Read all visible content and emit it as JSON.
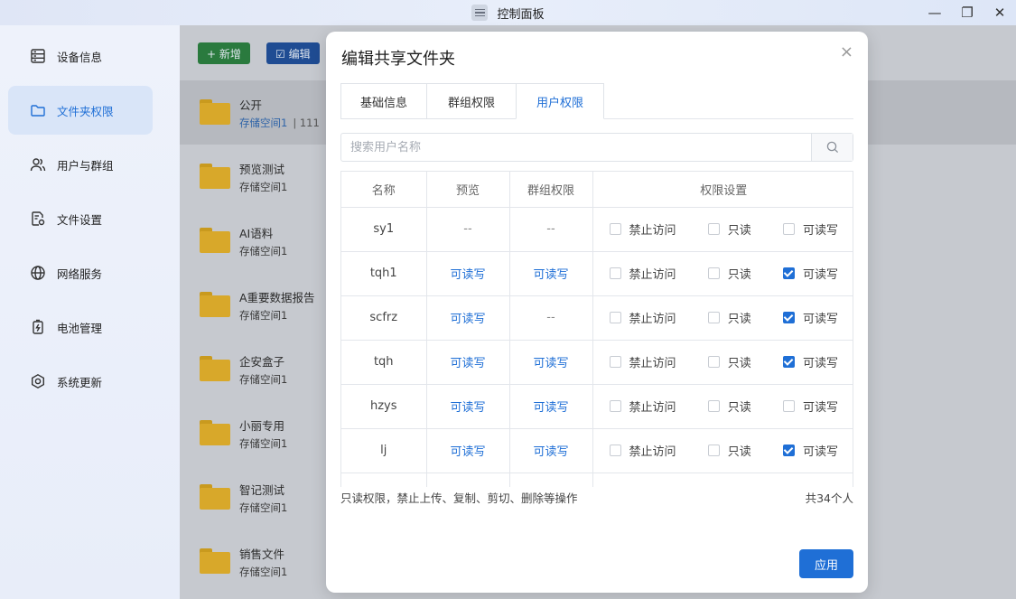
{
  "window": {
    "title": "控制面板",
    "controls": [
      "—",
      "❐",
      "✕"
    ]
  },
  "sidebar": {
    "items": [
      {
        "label": "设备信息",
        "icon": "server-icon",
        "active": false
      },
      {
        "label": "文件夹权限",
        "icon": "folder-icon",
        "active": true
      },
      {
        "label": "用户与群组",
        "icon": "users-icon",
        "active": false
      },
      {
        "label": "文件设置",
        "icon": "file-settings-icon",
        "active": false
      },
      {
        "label": "网络服务",
        "icon": "globe-icon",
        "active": false
      },
      {
        "label": "电池管理",
        "icon": "battery-icon",
        "active": false
      },
      {
        "label": "系统更新",
        "icon": "update-icon",
        "active": false
      }
    ]
  },
  "toolbar": {
    "add_label": "+ 新增",
    "edit_label": "☑ 编辑"
  },
  "folders": [
    {
      "name": "公开",
      "sub": "存储空间1",
      "extra": "|  111"
    },
    {
      "name": "预览测试",
      "sub": "存储空间1"
    },
    {
      "name": "AI语料",
      "sub": "存储空间1"
    },
    {
      "name": "A重要数据报告",
      "sub": "存储空间1"
    },
    {
      "name": "企安盒子",
      "sub": "存储空间1"
    },
    {
      "name": "小丽专用",
      "sub": "存储空间1"
    },
    {
      "name": "智记测试",
      "sub": "存储空间1"
    },
    {
      "name": "销售文件",
      "sub": "存储空间1"
    }
  ],
  "modal": {
    "title": "编辑共享文件夹",
    "close": "×",
    "tabs": [
      "基础信息",
      "群组权限",
      "用户权限"
    ],
    "active_tab": 2,
    "search_placeholder": "搜索用户名称",
    "columns": [
      "名称",
      "预览",
      "群组权限",
      "权限设置"
    ],
    "perm_options": [
      "禁止访问",
      "只读",
      "可读写"
    ],
    "rows": [
      {
        "name": "sy1",
        "preview": "--",
        "group": "--",
        "checked": [
          false,
          false,
          false
        ]
      },
      {
        "name": "tqh1",
        "preview": "可读写",
        "group": "可读写",
        "checked": [
          false,
          false,
          true
        ]
      },
      {
        "name": "scfrz",
        "preview": "可读写",
        "group": "--",
        "checked": [
          false,
          false,
          true
        ]
      },
      {
        "name": "tqh",
        "preview": "可读写",
        "group": "可读写",
        "checked": [
          false,
          false,
          true
        ]
      },
      {
        "name": "hzys",
        "preview": "可读写",
        "group": "可读写",
        "checked": [
          false,
          false,
          false
        ]
      },
      {
        "name": "lj",
        "preview": "可读写",
        "group": "可读写",
        "checked": [
          false,
          false,
          true
        ]
      }
    ],
    "note": "只读权限，禁止上传、复制、剪切、删除等操作",
    "total": "共34个人",
    "apply_label": "应用"
  }
}
